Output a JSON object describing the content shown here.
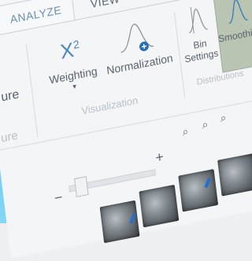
{
  "tabs": {
    "analyze": "ANALYZE",
    "view": "VIEW"
  },
  "ribbon": {
    "left_partial_label": "ure",
    "weighting_symbol": "X",
    "weighting_superscript": "2",
    "weighting_label": "Weighting",
    "normalization_label": "Normalization",
    "bin_settings_line1": "Bin",
    "bin_settings_line2": "Settings",
    "smoothing_label": "Smoothing",
    "group_visualization": "Visualization",
    "group_distributions": "Distributions",
    "group_left_partial": "ure"
  },
  "zoom": {
    "minus": "−",
    "plus": "+"
  },
  "colors": {
    "accent_blue": "#2aa7d8",
    "tab_active": "#6b8fb0",
    "smoothing_highlight": "#b9c4b3"
  }
}
